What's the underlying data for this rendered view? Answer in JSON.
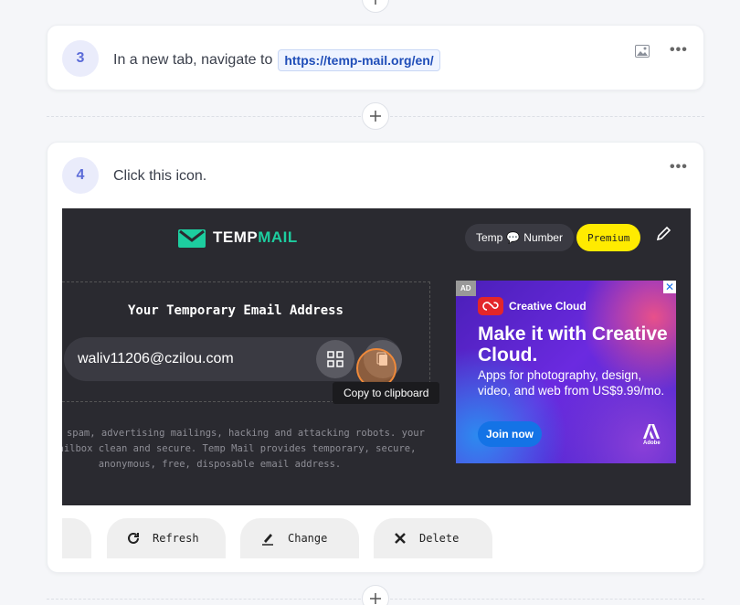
{
  "step3": {
    "number": "3",
    "text": "In a new tab, navigate to",
    "url": "https://temp-mail.org/en/"
  },
  "step4": {
    "number": "4",
    "text": "Click this icon."
  },
  "screenshot": {
    "logo_part1": "TEMP",
    "logo_part2": "MAIL",
    "pill_temp": "Temp",
    "pill_number": "Number",
    "premium": "Premium",
    "address_title": "Your Temporary Email Address",
    "email": "waliv11206@czilou.com",
    "tooltip": "Copy to clipboard",
    "description": "et about spam, advertising mailings, hacking and attacking robots. your real mailbox clean and secure. Temp Mail provides temporary, secure, anonymous, free, disposable email address.",
    "ad": {
      "tag": "AD",
      "close": "✕",
      "brand": "Creative Cloud",
      "headline": "Make it with Creative Cloud.",
      "body": "Apps for photography, design, video, and web from US$9.99/mo.",
      "cta": "Join now",
      "adobe": "Adobe"
    },
    "actions": {
      "refresh": "Refresh",
      "change": "Change",
      "delete": "Delete"
    }
  },
  "colors": {
    "accent": "#5b6bd8",
    "tempmail_green": "#1dcd9f",
    "premium_yellow": "#ffeb00",
    "highlight_orange": "#f08a3a"
  }
}
